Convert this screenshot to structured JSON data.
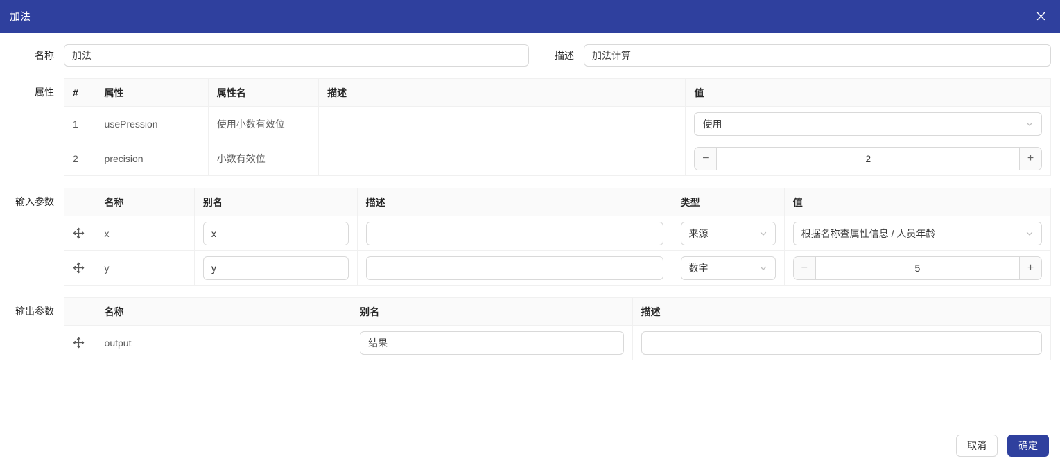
{
  "dialog": {
    "title": "加法"
  },
  "form": {
    "name_label": "名称",
    "name_value": "加法",
    "desc_label": "描述",
    "desc_value": "加法计算"
  },
  "attributes": {
    "section_label": "属性",
    "columns": [
      "#",
      "属性",
      "属性名",
      "描述",
      "值"
    ],
    "rows": [
      {
        "index": "1",
        "attr": "usePression",
        "attr_name": "使用小数有效位",
        "desc": "",
        "value": "使用"
      },
      {
        "index": "2",
        "attr": "precision",
        "attr_name": "小数有效位",
        "desc": "",
        "value": "2"
      }
    ]
  },
  "input_params": {
    "section_label": "输入参数",
    "columns": [
      "",
      "名称",
      "别名",
      "描述",
      "类型",
      "值"
    ],
    "rows": [
      {
        "name": "x",
        "alias": "x",
        "desc": "",
        "type": "来源",
        "value": "根据名称查属性信息 / 人员年龄"
      },
      {
        "name": "y",
        "alias": "y",
        "desc": "",
        "type": "数字",
        "value": "5"
      }
    ]
  },
  "output_params": {
    "section_label": "输出参数",
    "columns": [
      "",
      "名称",
      "别名",
      "描述"
    ],
    "rows": [
      {
        "name": "output",
        "alias": "结果",
        "desc": ""
      }
    ]
  },
  "footer": {
    "cancel_label": "取消",
    "confirm_label": "确定"
  },
  "colors": {
    "header_bg": "#2f409e",
    "primary_button": "#2f409e",
    "input_border": "#d9d9d9",
    "table_border": "#f0f0f0",
    "table_header_bg": "#fafafa"
  }
}
